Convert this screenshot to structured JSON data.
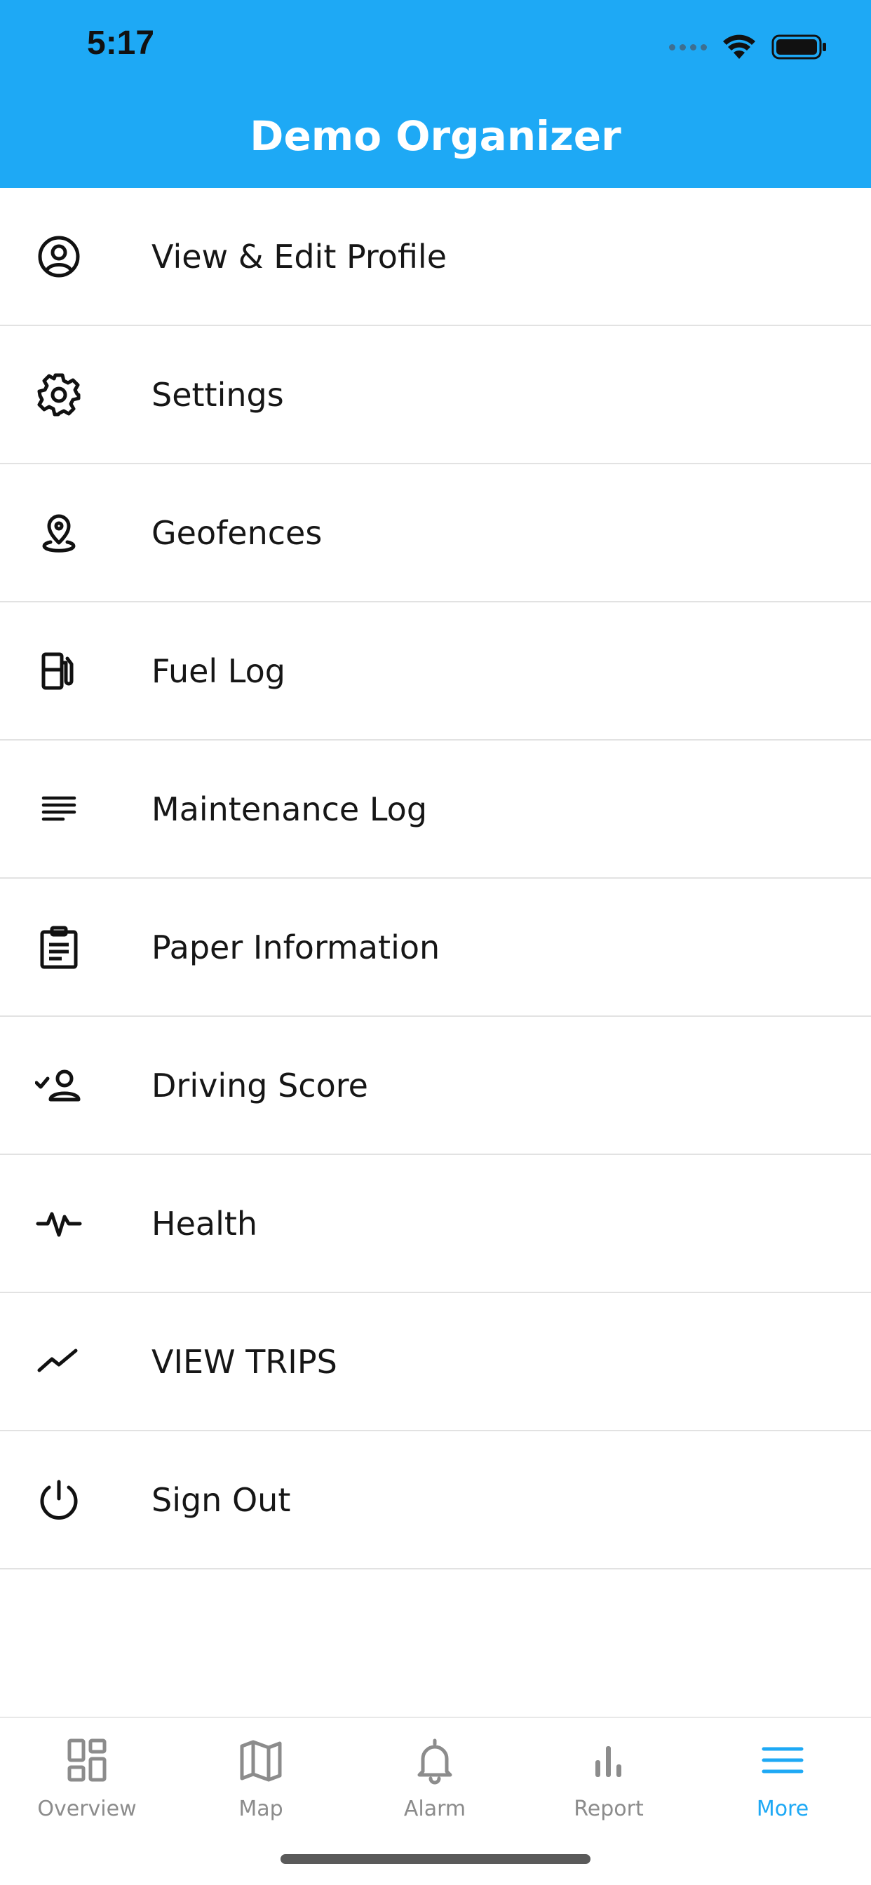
{
  "status_bar": {
    "time": "5:17"
  },
  "header": {
    "title": "Demo Organizer",
    "color": "#1ea9f5"
  },
  "menu": {
    "items": [
      {
        "label": "View & Edit Profile",
        "icon": "profile-icon"
      },
      {
        "label": "Settings",
        "icon": "gear-icon"
      },
      {
        "label": "Geofences",
        "icon": "location-pin-icon"
      },
      {
        "label": "Fuel Log",
        "icon": "fuel-pump-icon"
      },
      {
        "label": "Maintenance Log",
        "icon": "notes-lines-icon"
      },
      {
        "label": "Paper Information",
        "icon": "clipboard-icon"
      },
      {
        "label": "Driving Score",
        "icon": "user-check-icon"
      },
      {
        "label": "Health",
        "icon": "heartbeat-icon"
      },
      {
        "label": "VIEW TRIPS",
        "icon": "trend-line-icon"
      },
      {
        "label": "Sign Out",
        "icon": "power-icon"
      }
    ]
  },
  "tabbar": {
    "active": "More",
    "active_color": "#1ea9f5",
    "tabs": [
      {
        "label": "Overview",
        "icon": "dashboard-icon"
      },
      {
        "label": "Map",
        "icon": "map-icon"
      },
      {
        "label": "Alarm",
        "icon": "bell-icon"
      },
      {
        "label": "Report",
        "icon": "bar-chart-icon"
      },
      {
        "label": "More",
        "icon": "hamburger-menu-icon"
      }
    ]
  }
}
